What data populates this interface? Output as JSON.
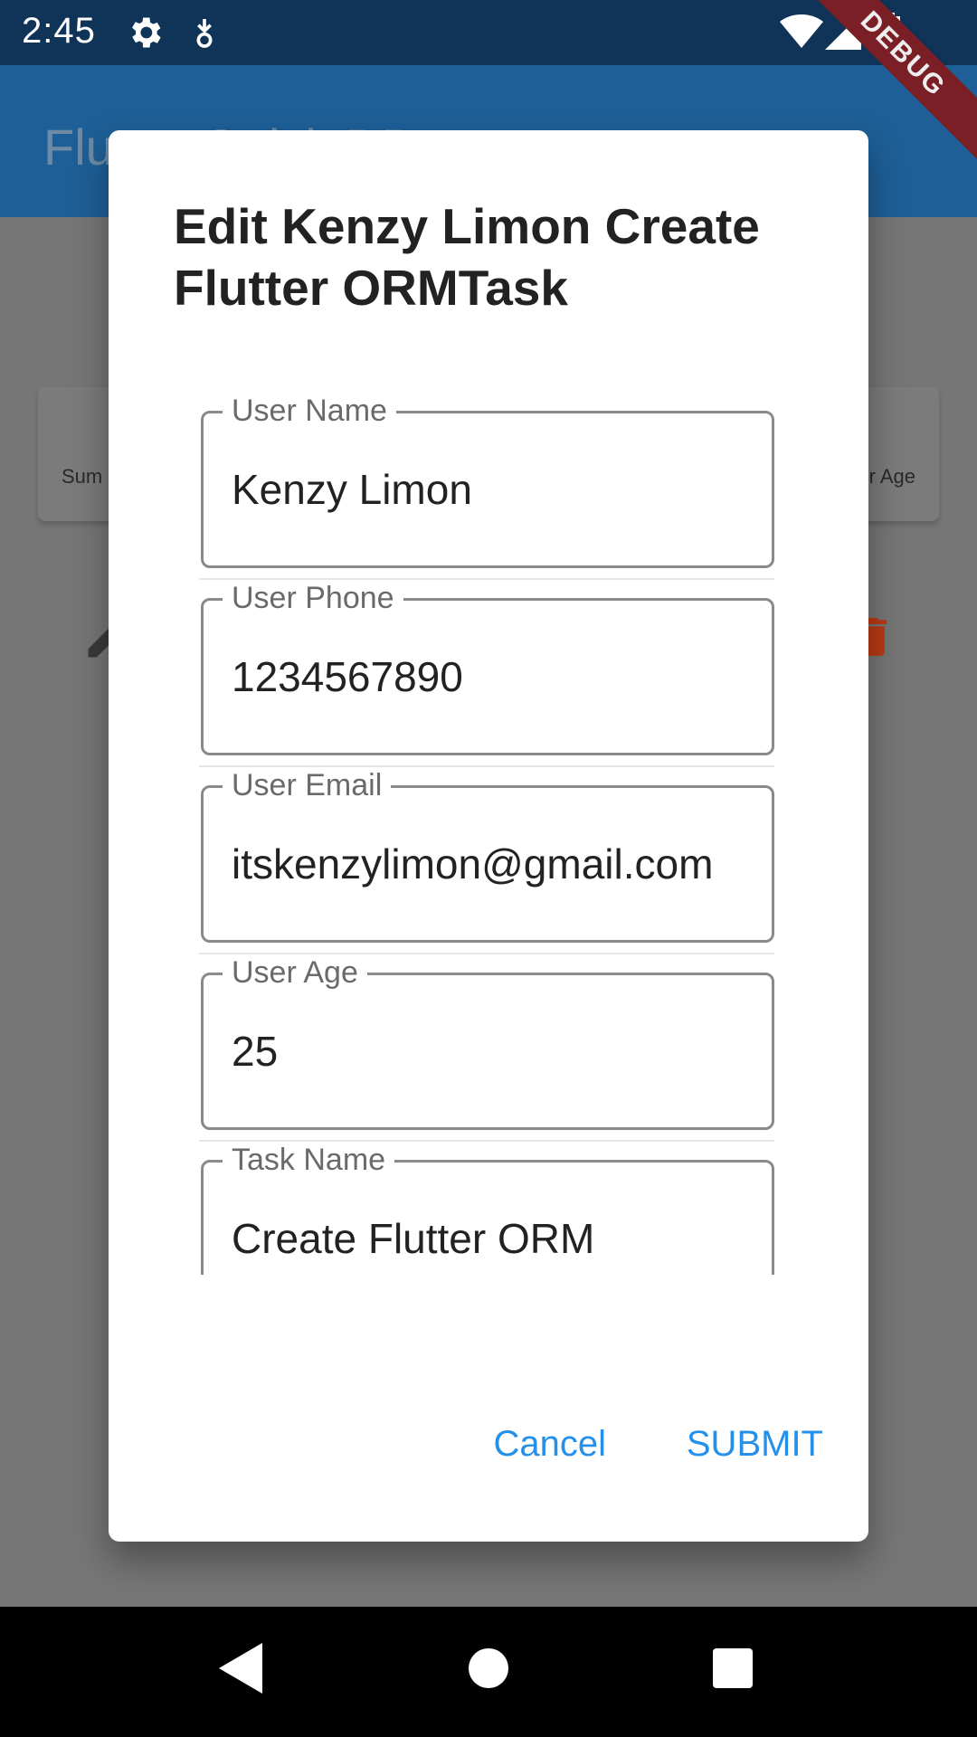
{
  "status_bar": {
    "time": "2:45",
    "icons": [
      "gear-icon",
      "download-icon",
      "wifi-icon",
      "signal-icon",
      "battery-icon"
    ]
  },
  "app_bar": {
    "title": "Flutter Quick DB"
  },
  "background_card": {
    "left_text": "Sum",
    "right_text": "r Age"
  },
  "debug_banner": "DEBUG",
  "dialog": {
    "title": "Edit Kenzy Limon Create Flutter ORMTask",
    "fields": [
      {
        "label": "User Name",
        "value": "Kenzy Limon"
      },
      {
        "label": "User Phone",
        "value": "1234567890"
      },
      {
        "label": "User Email",
        "value": "itskenzylimon@gmail.com"
      },
      {
        "label": "User Age",
        "value": "25"
      },
      {
        "label": "Task Name",
        "value": "Create Flutter ORM"
      }
    ],
    "cancel_label": "Cancel",
    "submit_label": "SUBMIT"
  },
  "colors": {
    "status_bar": "#0f3457",
    "app_bar": "#1e5f97",
    "accent": "#2590ea",
    "delete_icon": "#b83a14",
    "debug_ribbon": "#7a1f25"
  }
}
